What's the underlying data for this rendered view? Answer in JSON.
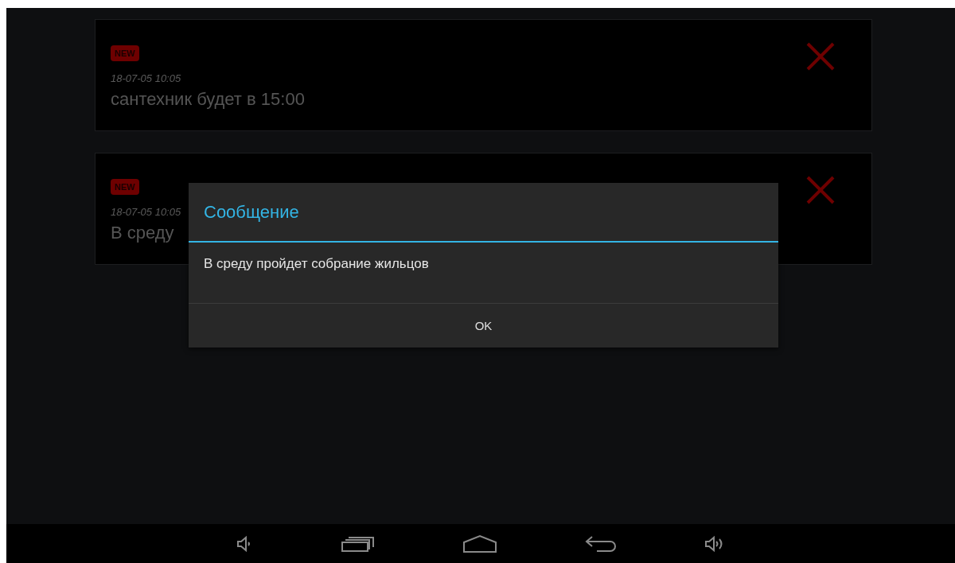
{
  "messages": [
    {
      "badge": "NEW",
      "time": "18-07-05 10:05",
      "text": "сантехник будет в 15:00"
    },
    {
      "badge": "NEW",
      "time": "18-07-05 10:05",
      "text": "В среду"
    }
  ],
  "dialog": {
    "title": "Сообщение",
    "message": "В среду пройдет собрание жильцов",
    "button": "OK"
  }
}
